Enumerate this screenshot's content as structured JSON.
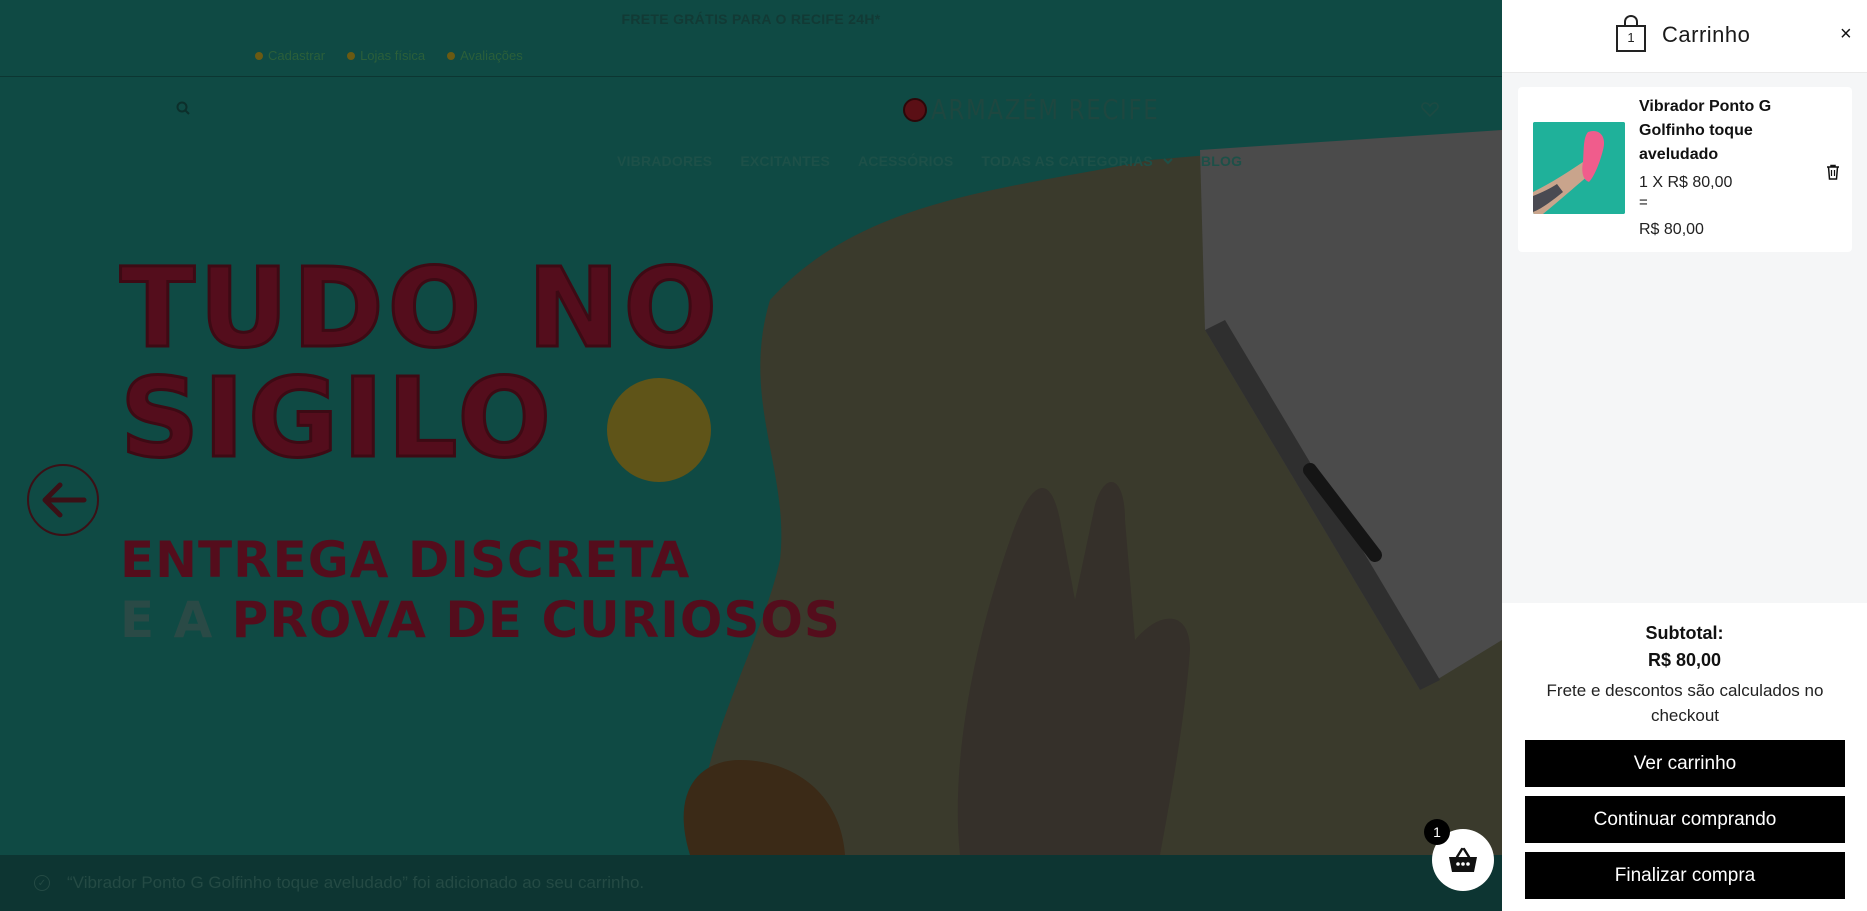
{
  "site": {
    "announcement": "FRETE GRÁTIS PARA O RECIFE 24H*",
    "top_links": [
      "Cadastrar",
      "Lojas física",
      "Avaliações"
    ],
    "logo_text": "ARMAZÉM RECIFE",
    "nav": [
      "VIBRADORES",
      "EXCITANTES",
      "ACESSÓRIOS",
      "TODAS AS CATEGORIAS",
      "BLOG"
    ],
    "hero": {
      "line1": "TUDO NO",
      "line2": "SIGILO",
      "sub1": "ENTREGA DISCRETA",
      "sub2_muted": "E A ",
      "sub2": "PROVA DE CURIOSOS"
    },
    "notice": "“Vibrador Ponto G Golfinho toque aveludado” foi adicionado ao seu carrinho.",
    "cart_fab_count": "1"
  },
  "drawer": {
    "title": "Carrinho",
    "bag_count": "1",
    "close": "×",
    "item": {
      "name": "Vibrador Ponto G Golfinho toque aveludado",
      "qty_line": "1 X R$ 80,00",
      "equals": "=",
      "line_total": "R$ 80,00"
    },
    "subtotal_label": "Subtotal:",
    "subtotal_value": "R$ 80,00",
    "note": "Frete e descontos são calculados no checkout",
    "buttons": {
      "view_cart": "Ver carrinho",
      "continue": "Continuar comprando",
      "checkout": "Finalizar compra"
    }
  },
  "colors": {
    "overlay_teal": "#0f4a44",
    "hero_red": "#540d1c",
    "button_black": "#000000",
    "drawer_bg": "#f5f6f7"
  }
}
